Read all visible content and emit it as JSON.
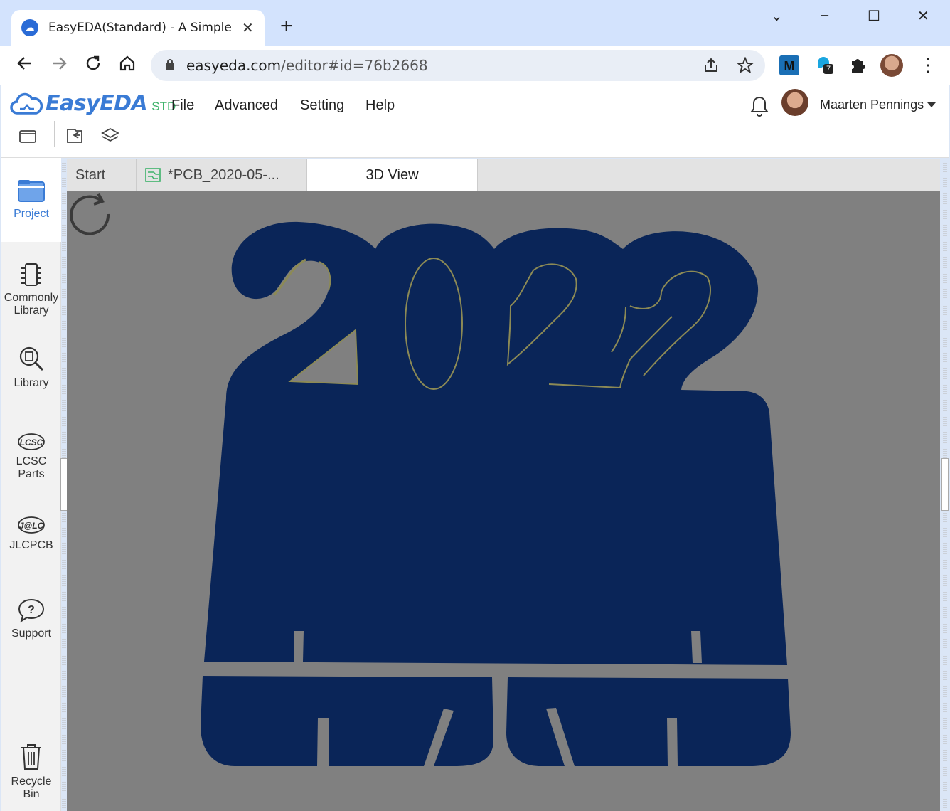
{
  "browser": {
    "tab_title": "EasyEDA(Standard) - A Simple and Powerful Electronic Circuit Design Tool",
    "tab_close": "✕",
    "new_tab": "+",
    "url_host": "easyeda.com",
    "url_path": "/editor#id=76b2668",
    "extension_badge": "7",
    "window_controls": {
      "minimize": "–",
      "maximize": "☐",
      "close": "✕",
      "tab_search": "⌄"
    }
  },
  "app": {
    "brand": "EasyEDA",
    "edition": "STD",
    "menu": [
      "File",
      "Advanced",
      "Setting",
      "Help"
    ],
    "user_name": "Maarten Pennings"
  },
  "sidebar": {
    "items": [
      {
        "label_1": "Project",
        "label_2": ""
      },
      {
        "label_1": "Commonly",
        "label_2": "Library"
      },
      {
        "label_1": "Library",
        "label_2": ""
      },
      {
        "label_1": "LCSC",
        "label_2": "Parts"
      },
      {
        "label_1": "JLCPCB",
        "label_2": ""
      },
      {
        "label_1": "Support",
        "label_2": ""
      },
      {
        "label_1": "Recycle",
        "label_2": "Bin"
      }
    ],
    "lcsc_logo_text": "LCSC",
    "jlc_logo_text": "J@LC"
  },
  "doc_tabs": [
    {
      "label": "Start"
    },
    {
      "label": "*PCB_2020-05-..."
    },
    {
      "label": "3D View"
    }
  ],
  "viewport": {
    "background": "#808080",
    "board_color": "#0a2558",
    "edge_color": "#8c8a55"
  }
}
